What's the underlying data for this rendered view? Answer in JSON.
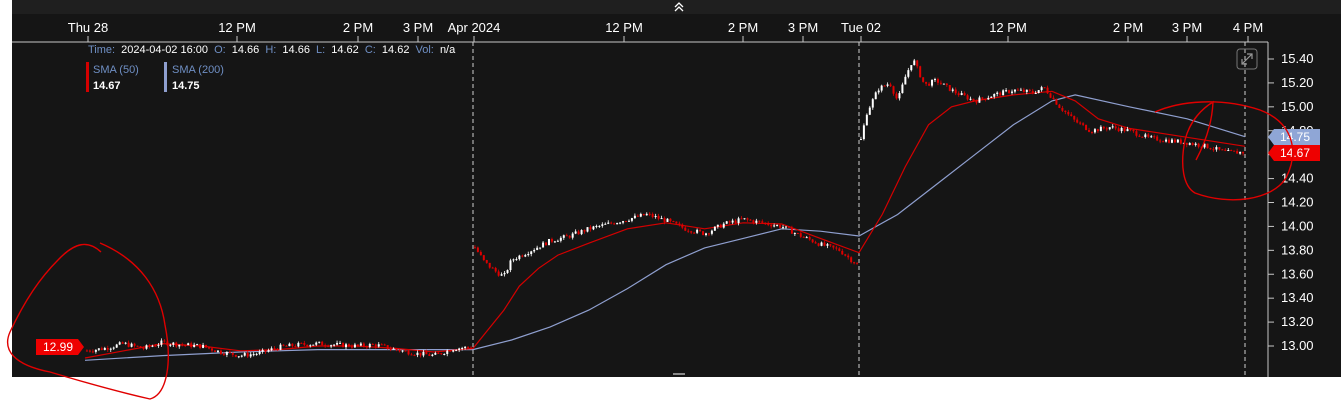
{
  "header": {
    "collapse_icon": "double-chevron-up-icon"
  },
  "legend": {
    "time_label": "Time:",
    "time_value": "2024-04-02 16:00",
    "open_label": "O:",
    "open_value": "14.66",
    "high_label": "H:",
    "high_value": "14.66",
    "low_label": "L:",
    "low_value": "14.62",
    "close_label": "C:",
    "close_value": "14.62",
    "vol_label": "Vol:",
    "vol_value": "n/a",
    "sma50_label": "SMA (50)",
    "sma50_value": "14.67",
    "sma200_label": "SMA (200)",
    "sma200_value": "14.75"
  },
  "badges": {
    "left_price": "12.99",
    "right_sma200": "14.75",
    "right_sma50": "14.67"
  },
  "colors": {
    "background": "#151515",
    "candle_up": "#ffffff",
    "candle_down": "#e00000",
    "sma50": "#d40000",
    "sma200": "#8f9fcf",
    "annotation": "#e00000",
    "badge_red": "#ee0000",
    "badge_blue": "#8fa6d6"
  },
  "chart_data": {
    "type": "candlestick",
    "x_tick_labels": [
      "Thu 28",
      "12 PM",
      "2 PM",
      "3 PM",
      "Apr 2024",
      "12 PM",
      "2 PM",
      "3 PM",
      "Tue 02",
      "12 PM",
      "2 PM",
      "3 PM",
      "4 PM"
    ],
    "y_tick_labels": [
      "15.40",
      "15.20",
      "15.00",
      "14.80",
      "14.60",
      "14.40",
      "14.20",
      "14.00",
      "13.80",
      "13.60",
      "13.40",
      "13.20",
      "13.00"
    ],
    "ylim": [
      12.88,
      15.48
    ],
    "sessions": [
      "Thu 28",
      "Apr 2024",
      "Tue 02"
    ],
    "close_path": [
      [
        0.0,
        12.96
      ],
      [
        0.05,
        12.98
      ],
      [
        0.1,
        13.02
      ],
      [
        0.15,
        12.98
      ],
      [
        0.2,
        13.03
      ],
      [
        0.25,
        13.01
      ],
      [
        0.3,
        13.0
      ],
      [
        0.35,
        12.95
      ],
      [
        0.4,
        12.92
      ],
      [
        0.45,
        12.94
      ],
      [
        0.5,
        12.99
      ],
      [
        0.55,
        13.01
      ],
      [
        0.6,
        13.02
      ],
      [
        0.65,
        13.01
      ],
      [
        0.7,
        13.0
      ],
      [
        0.75,
        13.01
      ],
      [
        0.8,
        12.97
      ],
      [
        0.85,
        12.94
      ],
      [
        0.9,
        12.92
      ],
      [
        0.95,
        12.98
      ],
      [
        1.0,
        12.99
      ],
      [
        1.0,
        13.85
      ],
      [
        1.03,
        13.7
      ],
      [
        1.06,
        13.62
      ],
      [
        1.08,
        13.58
      ],
      [
        1.1,
        13.72
      ],
      [
        1.15,
        13.8
      ],
      [
        1.2,
        13.88
      ],
      [
        1.25,
        13.92
      ],
      [
        1.3,
        13.98
      ],
      [
        1.35,
        14.02
      ],
      [
        1.4,
        14.06
      ],
      [
        1.45,
        14.1
      ],
      [
        1.5,
        14.05
      ],
      [
        1.55,
        13.98
      ],
      [
        1.6,
        13.94
      ],
      [
        1.65,
        14.02
      ],
      [
        1.7,
        14.06
      ],
      [
        1.75,
        14.03
      ],
      [
        1.8,
        14.0
      ],
      [
        1.85,
        13.92
      ],
      [
        1.9,
        13.85
      ],
      [
        1.95,
        13.8
      ],
      [
        1.98,
        13.72
      ],
      [
        2.0,
        13.67
      ],
      [
        2.0,
        14.65
      ],
      [
        2.02,
        14.95
      ],
      [
        2.05,
        15.15
      ],
      [
        2.08,
        15.2
      ],
      [
        2.1,
        15.05
      ],
      [
        2.12,
        15.25
      ],
      [
        2.14,
        15.4
      ],
      [
        2.17,
        15.18
      ],
      [
        2.2,
        15.22
      ],
      [
        2.25,
        15.12
      ],
      [
        2.3,
        15.05
      ],
      [
        2.35,
        15.1
      ],
      [
        2.4,
        15.14
      ],
      [
        2.45,
        15.12
      ],
      [
        2.48,
        15.16
      ],
      [
        2.52,
        15.0
      ],
      [
        2.56,
        14.88
      ],
      [
        2.6,
        14.8
      ],
      [
        2.65,
        14.83
      ],
      [
        2.7,
        14.8
      ],
      [
        2.75,
        14.74
      ],
      [
        2.8,
        14.72
      ],
      [
        2.85,
        14.7
      ],
      [
        2.9,
        14.67
      ],
      [
        2.95,
        14.62
      ],
      [
        3.0,
        14.62
      ]
    ],
    "sma50_path": [
      [
        0.0,
        12.9
      ],
      [
        0.1,
        12.96
      ],
      [
        0.2,
        13.02
      ],
      [
        0.3,
        13.0
      ],
      [
        0.4,
        12.96
      ],
      [
        0.5,
        12.97
      ],
      [
        0.6,
        13.0
      ],
      [
        0.7,
        13.0
      ],
      [
        0.8,
        12.98
      ],
      [
        0.9,
        12.95
      ],
      [
        1.0,
        12.98
      ],
      [
        1.03,
        13.1
      ],
      [
        1.08,
        13.3
      ],
      [
        1.12,
        13.5
      ],
      [
        1.17,
        13.65
      ],
      [
        1.22,
        13.76
      ],
      [
        1.3,
        13.86
      ],
      [
        1.4,
        13.98
      ],
      [
        1.5,
        14.03
      ],
      [
        1.6,
        13.98
      ],
      [
        1.7,
        14.03
      ],
      [
        1.8,
        14.02
      ],
      [
        1.9,
        13.9
      ],
      [
        2.0,
        13.78
      ],
      [
        2.06,
        14.1
      ],
      [
        2.12,
        14.5
      ],
      [
        2.18,
        14.85
      ],
      [
        2.24,
        15.0
      ],
      [
        2.3,
        15.05
      ],
      [
        2.4,
        15.1
      ],
      [
        2.5,
        15.13
      ],
      [
        2.56,
        15.05
      ],
      [
        2.62,
        14.9
      ],
      [
        2.7,
        14.82
      ],
      [
        2.8,
        14.77
      ],
      [
        2.9,
        14.72
      ],
      [
        3.0,
        14.67
      ]
    ],
    "sma200_path": [
      [
        0.0,
        12.88
      ],
      [
        0.2,
        12.92
      ],
      [
        0.4,
        12.95
      ],
      [
        0.6,
        12.97
      ],
      [
        0.8,
        12.97
      ],
      [
        1.0,
        12.97
      ],
      [
        1.1,
        13.05
      ],
      [
        1.2,
        13.16
      ],
      [
        1.3,
        13.3
      ],
      [
        1.4,
        13.48
      ],
      [
        1.5,
        13.68
      ],
      [
        1.6,
        13.82
      ],
      [
        1.7,
        13.9
      ],
      [
        1.8,
        13.98
      ],
      [
        1.9,
        13.96
      ],
      [
        2.0,
        13.92
      ],
      [
        2.1,
        14.1
      ],
      [
        2.2,
        14.35
      ],
      [
        2.3,
        14.6
      ],
      [
        2.4,
        14.85
      ],
      [
        2.5,
        15.05
      ],
      [
        2.56,
        15.1
      ],
      [
        2.7,
        15.0
      ],
      [
        2.85,
        14.9
      ],
      [
        3.0,
        14.75
      ]
    ]
  }
}
